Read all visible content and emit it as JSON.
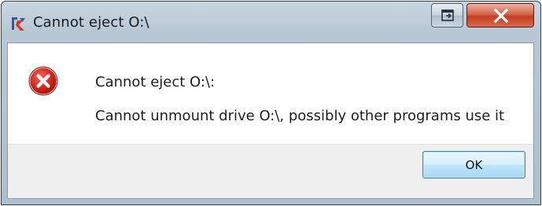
{
  "window": {
    "title": "Cannot eject O:\\",
    "app_icon": "app-logo-icon",
    "controls": {
      "restore_icon": "restore-window-icon",
      "close_icon": "close-icon"
    }
  },
  "message": {
    "icon": "error-icon",
    "title": "Cannot eject O:\\:",
    "body": "Cannot unmount drive O:\\, possibly other programs use it"
  },
  "buttons": {
    "ok_label": "OK"
  },
  "colors": {
    "close_button": "#c33d22",
    "error_red": "#d32a1f",
    "ok_border": "#3c7fb1"
  }
}
